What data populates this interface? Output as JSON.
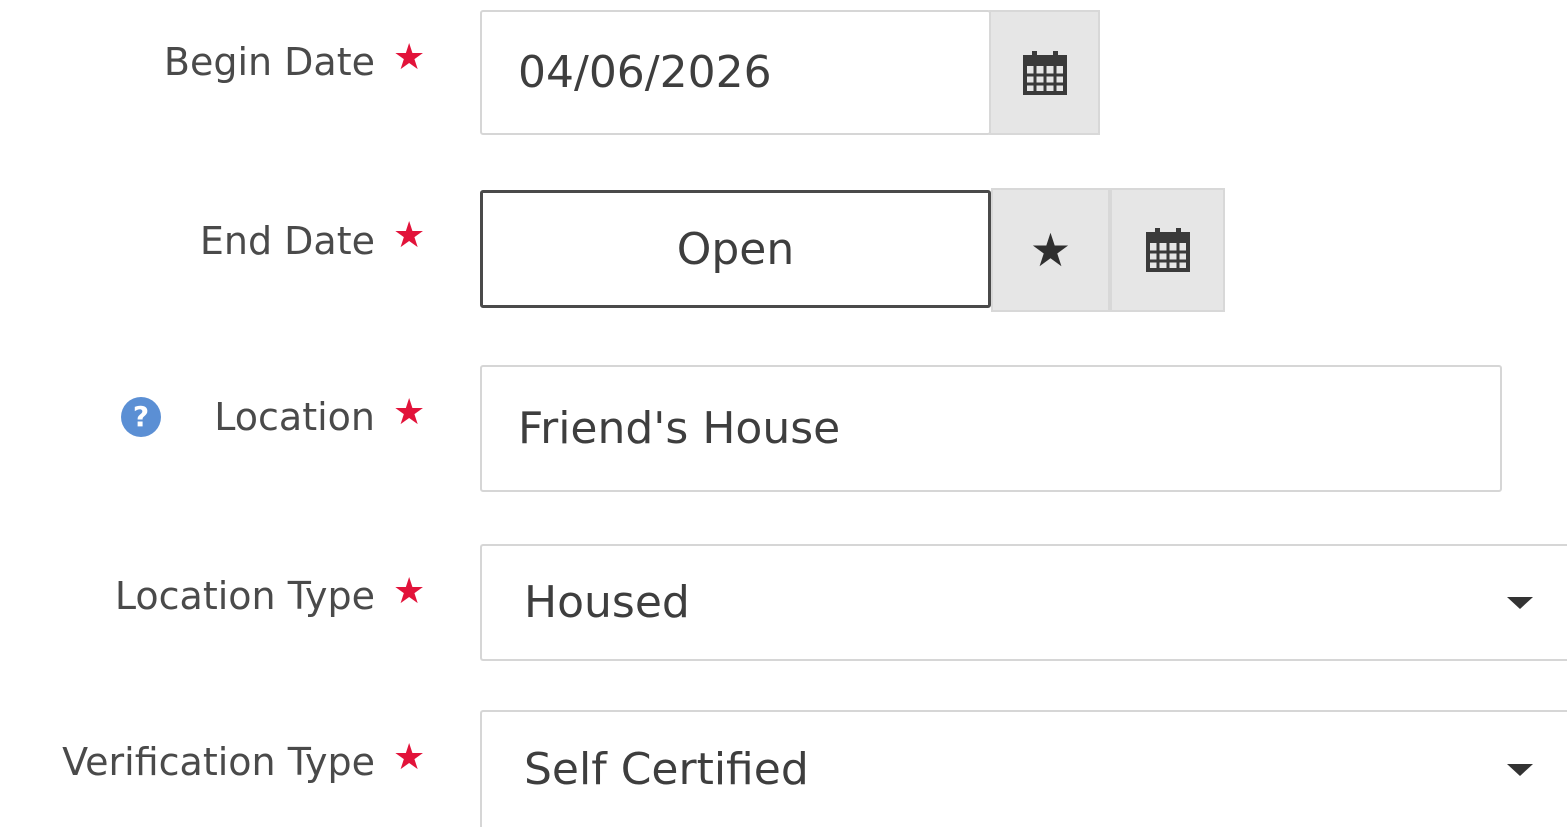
{
  "form": {
    "required_marker": "★",
    "begin_date": {
      "label": "Begin Date",
      "value": "04/06/2026",
      "calendar_icon": "calendar-icon"
    },
    "end_date": {
      "label": "End Date",
      "value": "Open",
      "star_icon": "star-icon",
      "star_glyph": "★",
      "calendar_icon": "calendar-icon"
    },
    "location": {
      "label": "Location",
      "help_icon": "help-icon",
      "help_glyph": "?",
      "value": "Friend's House"
    },
    "location_type": {
      "label": "Location Type",
      "selected": "Housed",
      "dropdown_icon": "caret-down-icon"
    },
    "verification_type": {
      "label": "Verification Type",
      "selected": "Self Certified",
      "dropdown_icon": "caret-down-icon"
    }
  },
  "colors": {
    "required": "#e2133a",
    "help_icon": "#5b8fd4",
    "label_text": "#4a4a4a",
    "addon_background": "#e6e6e6"
  }
}
